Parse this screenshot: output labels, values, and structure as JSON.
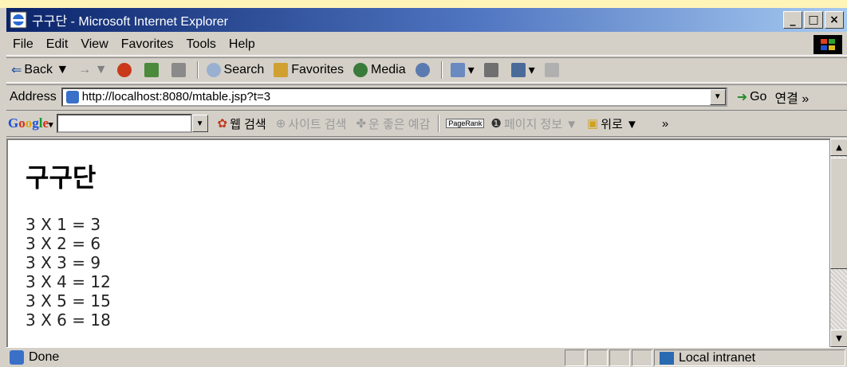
{
  "window": {
    "title": "구구단 - Microsoft Internet Explorer",
    "buttons": [
      "_",
      "□",
      "×"
    ]
  },
  "menu": [
    "File",
    "Edit",
    "View",
    "Favorites",
    "Tools",
    "Help"
  ],
  "toolbar": {
    "back": "Back ▼",
    "forward": "→ ▼",
    "search": "Search",
    "favorites": "Favorites",
    "media": "Media"
  },
  "address": {
    "label": "Address",
    "url": "http://localhost:8080/mtable.jsp?t=3",
    "go": "Go",
    "links": "연결 »"
  },
  "google": {
    "logo": "Google",
    "web_search": "웹 검색",
    "site_search": "사이트 검색",
    "lucky": "운 좋은 예감",
    "page_rank_tag": "PageRank",
    "page_info": "페이지 정보 ▼",
    "up": "위로 ▼",
    "more": "»"
  },
  "page": {
    "heading": "구구단",
    "lines": [
      "3 X 1 = 3",
      "3 X 2 = 6",
      "3 X 3 = 9",
      "3 X 4 = 12",
      "3 X 5 = 15",
      "3 X 6 = 18"
    ]
  },
  "status": {
    "text": "Done",
    "zone": "Local intranet"
  }
}
